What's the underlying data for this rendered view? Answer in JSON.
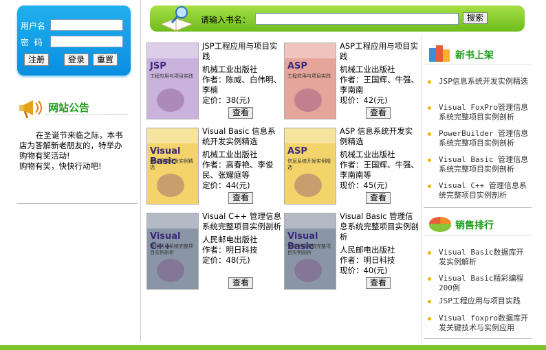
{
  "login": {
    "username_label": "用户名",
    "password_label": "密  码",
    "register_btn": "注册",
    "login_btn": "登录",
    "reset_btn": "重置"
  },
  "notice": {
    "title": "网站公告",
    "lines": [
      "在圣诞节来临之际，本书店为答解新老朋友的，特举办购物有奖活动!",
      "购物有奖，快快行动吧!"
    ]
  },
  "search": {
    "label": "请输入书名：",
    "button": "搜索"
  },
  "books": [
    {
      "title": "JSP工程应用与项目实践",
      "publisher": "机械工业出版社",
      "author": "作者：陈威、白伟明、李楠",
      "price": "定价：38(元)",
      "view": "查看",
      "cover_title": "JSP",
      "cover_sub": "工程应用与项目实践",
      "cover_color": "#c9b3dc"
    },
    {
      "title": "ASP工程应用与项目实践",
      "publisher": "机械工业出版社",
      "author": "作者：王国辉、牛强、李南南",
      "price": "现价：42(元)",
      "view": "查看",
      "cover_title": "ASP",
      "cover_sub": "工程应用与项目实践",
      "cover_color": "#e6a59a"
    },
    {
      "title": "Visual Basic 信息系统开发实例精选",
      "publisher": "机械工业出版社",
      "author": "作者：高春艳、李俊民、张耀庭等",
      "price": "定价：44(元)",
      "view": "查看",
      "cover_title": "Visual Basic",
      "cover_sub": "信息系统开发实例精选",
      "cover_color": "#f2d46a"
    },
    {
      "title": "ASP 信息系统开发实例精选",
      "publisher": "机械工业出版社",
      "author": "作者：王国辉、牛强、李南南等",
      "price": "现价：45(元)",
      "view": "查看",
      "cover_title": "ASP",
      "cover_sub": "信息系统开发实例精选",
      "cover_color": "#f2d46a"
    },
    {
      "title": "Visual C++ 管理信息系统完整项目实例剖析",
      "publisher": "人民邮电出版社",
      "author": "作者：明日科技",
      "price": "定价：48(元)",
      "view": "查看",
      "cover_title": "Visual C++",
      "cover_sub": "管理信息系统完整项目实例剖析",
      "cover_color": "#8a96a8"
    },
    {
      "title": "Visual Basic 管理信息系统完整项目实例剖析",
      "publisher": "人民邮电出版社",
      "author": "作者：明日科技",
      "price": "现价：40(元)",
      "view": "查看",
      "cover_title": "Visual Basic",
      "cover_sub": "管理信息系统完整项目实例剖析",
      "cover_color": "#8a96a8"
    }
  ],
  "new_books": {
    "title": "新书上架",
    "items": [
      "JSP信息系统开发实例精选",
      "Visual FoxPro管理信息系统完整项目实例剖析",
      "PowerBuilder 管理信息系统完整项目实例剖析",
      "Visual Basic 管理信息系统完整项目实例剖析",
      "Visual C++ 管理信息系统完整项目实例剖析"
    ]
  },
  "sales": {
    "title": "销售排行",
    "items": [
      "Visual Basic数据库开发实例解析",
      "Visual Basic精彩编程200例",
      "JSP工程应用与项目实践",
      "Visual foxpro数据库开发关键技术与实例应用"
    ]
  },
  "colors": {
    "login_bg": "#0a9ee8",
    "search_bg": "#7cc427",
    "footer_bar": "#7cc427",
    "section_title": "#1a9e1a"
  }
}
